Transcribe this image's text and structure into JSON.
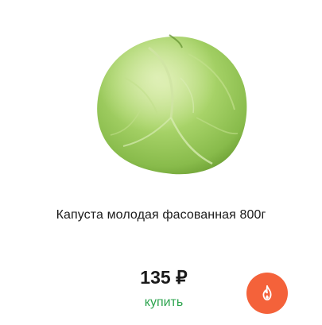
{
  "product": {
    "name": "Капуста молодая фасованная 800г",
    "price": "135 ₽",
    "buy_label": "купить",
    "image_icon": "cabbage-image",
    "action_icon": "flame-icon",
    "colors": {
      "accent_green": "#2ea44f",
      "fire_button": "#f4623a",
      "text": "#1a1a1a"
    }
  }
}
